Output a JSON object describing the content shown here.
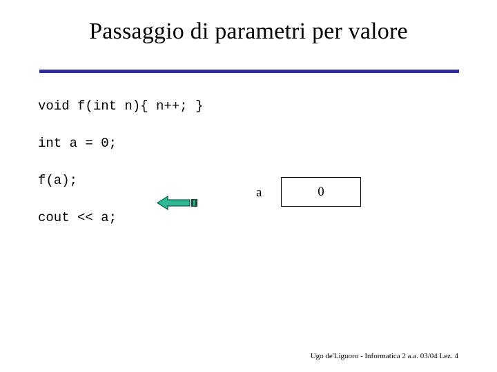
{
  "slide": {
    "title": "Passaggio di parametri per valore",
    "accent_color": "#2d2d9e",
    "background_color": "#ffffff"
  },
  "code": {
    "lines": [
      "void f(int n){ n++; }",
      "int a = 0;",
      "f(a);",
      "cout << a;"
    ]
  },
  "annotation": {
    "arrow": {
      "icon": "left-arrow-icon",
      "direction": "left",
      "fill_color": "#2eb894",
      "outline_color": "#0a5c45",
      "tail_color": "#1a4a37"
    },
    "variable": {
      "label": "a",
      "value": "0"
    }
  },
  "footer": {
    "text": "Ugo de'Liguoro - Informatica 2 a.a. 03/04 Lez. 4"
  }
}
